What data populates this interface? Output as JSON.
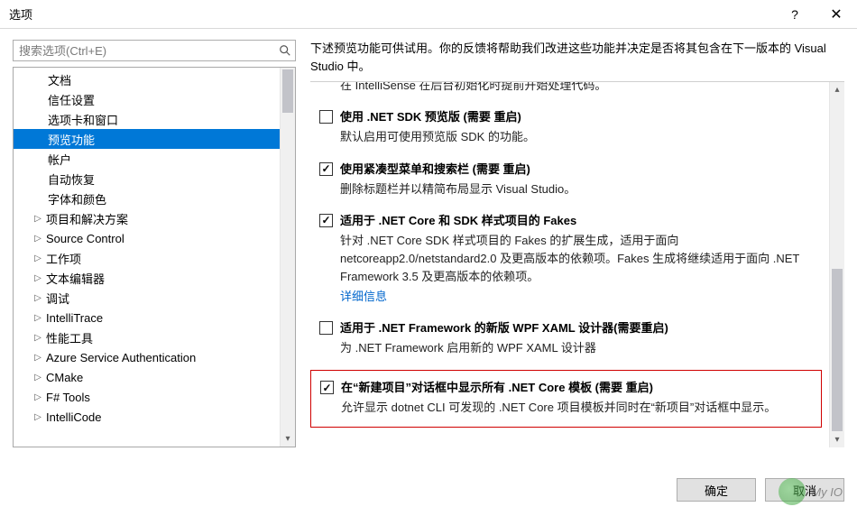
{
  "window": {
    "title": "选项",
    "help_symbol": "?",
    "close_symbol": "✕"
  },
  "search": {
    "placeholder": "搜索选项(Ctrl+E)"
  },
  "tree": {
    "items": [
      {
        "label": "文档",
        "indent": 2,
        "expander": "",
        "selected": false
      },
      {
        "label": "信任设置",
        "indent": 2,
        "expander": "",
        "selected": false
      },
      {
        "label": "选项卡和窗口",
        "indent": 2,
        "expander": "",
        "selected": false
      },
      {
        "label": "预览功能",
        "indent": 2,
        "expander": "",
        "selected": true
      },
      {
        "label": "帐户",
        "indent": 2,
        "expander": "",
        "selected": false
      },
      {
        "label": "自动恢复",
        "indent": 2,
        "expander": "",
        "selected": false
      },
      {
        "label": "字体和颜色",
        "indent": 2,
        "expander": "",
        "selected": false
      },
      {
        "label": "项目和解决方案",
        "indent": 1,
        "expander": "▷",
        "selected": false
      },
      {
        "label": "Source Control",
        "indent": 1,
        "expander": "▷",
        "selected": false
      },
      {
        "label": "工作项",
        "indent": 1,
        "expander": "▷",
        "selected": false
      },
      {
        "label": "文本编辑器",
        "indent": 1,
        "expander": "▷",
        "selected": false
      },
      {
        "label": "调试",
        "indent": 1,
        "expander": "▷",
        "selected": false
      },
      {
        "label": "IntelliTrace",
        "indent": 1,
        "expander": "▷",
        "selected": false
      },
      {
        "label": "性能工具",
        "indent": 1,
        "expander": "▷",
        "selected": false
      },
      {
        "label": "Azure Service Authentication",
        "indent": 1,
        "expander": "▷",
        "selected": false
      },
      {
        "label": "CMake",
        "indent": 1,
        "expander": "▷",
        "selected": false
      },
      {
        "label": "F# Tools",
        "indent": 1,
        "expander": "▷",
        "selected": false
      },
      {
        "label": "IntelliCode",
        "indent": 1,
        "expander": "▷",
        "selected": false
      }
    ]
  },
  "intro": "下述预览功能可供试用。你的反馈将帮助我们改进这些功能并决定是否将其包含在下一版本的 Visual Studio 中。",
  "options": [
    {
      "id": "intellisense-init",
      "title": "",
      "desc": "在 IntelliSense 在后台初始化时提前开始处理代码。",
      "checked": true,
      "truncated_top": true
    },
    {
      "id": "net-sdk-preview",
      "title": "使用 .NET SDK 预览版 (需要 重启)",
      "desc": "默认启用可使用预览版 SDK 的功能。",
      "checked": false
    },
    {
      "id": "compact-menu",
      "title": "使用紧凑型菜单和搜索栏 (需要 重启)",
      "desc": "删除标题栏并以精简布局显示 Visual Studio。",
      "checked": true
    },
    {
      "id": "fakes-sdk",
      "title": "适用于 .NET Core 和 SDK 样式项目的 Fakes",
      "desc": "针对 .NET Core SDK 样式项目的 Fakes 的扩展生成，适用于面向 netcoreapp2.0/netstandard2.0 及更高版本的依赖项。Fakes 生成将继续适用于面向 .NET Framework 3.5 及更高版本的依赖项。",
      "link": "详细信息",
      "checked": true
    },
    {
      "id": "wpf-xaml-designer",
      "title": "适用于 .NET Framework 的新版 WPF XAML 设计器(需要重启)",
      "desc": "为 .NET Framework 启用新的 WPF XAML 设计器",
      "checked": false
    },
    {
      "id": "show-netcore-templates",
      "title": "在“新建项目”对话框中显示所有 .NET Core 模板 (需要 重启)",
      "desc": "允许显示 dotnet CLI 可发现的 .NET Core 项目模板并同时在“新项目”对话框中显示。",
      "checked": true,
      "highlight": true
    }
  ],
  "buttons": {
    "ok": "确定",
    "cancel": "取消"
  },
  "watermark": {
    "text": "My IO"
  }
}
